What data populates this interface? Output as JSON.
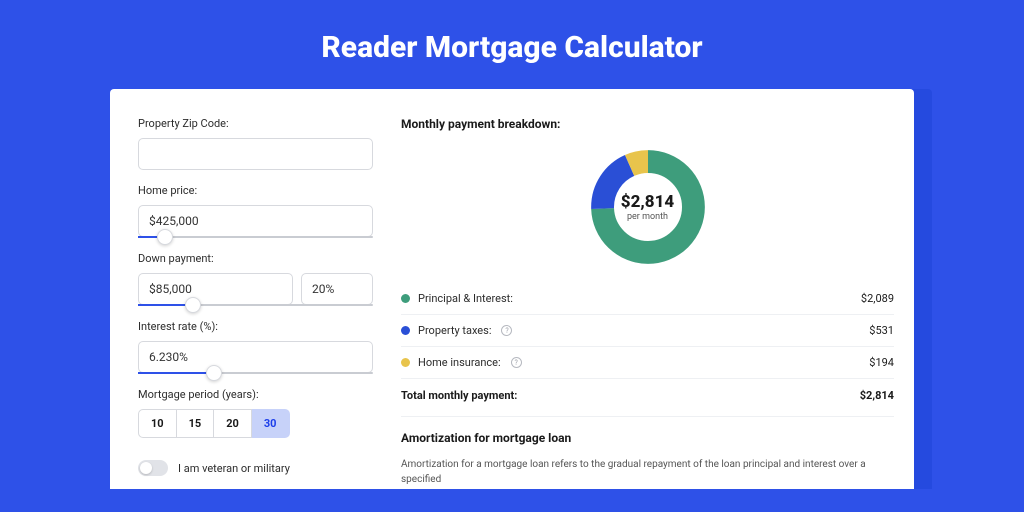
{
  "hero": {
    "title": "Reader Mortgage Calculator"
  },
  "form": {
    "zip": {
      "label": "Property Zip Code:",
      "value": ""
    },
    "home_price": {
      "label": "Home price:",
      "value": "$425,000",
      "slider_pct": 8
    },
    "down": {
      "label": "Down payment:",
      "amount": "$85,000",
      "percent": "20%",
      "slider_pct": 20
    },
    "rate": {
      "label": "Interest rate (%):",
      "value": "6.230%",
      "slider_pct": 29
    },
    "period": {
      "label": "Mortgage period (years):",
      "options": [
        "10",
        "15",
        "20",
        "30"
      ],
      "selected": "30"
    },
    "veteran": {
      "label": "I am veteran or military",
      "checked": false
    }
  },
  "breakdown": {
    "title": "Monthly payment breakdown:",
    "center_amount": "$2,814",
    "center_sub": "per month",
    "items": [
      {
        "label": "Principal & Interest:",
        "value": "$2,089",
        "color": "#3e9d7c",
        "has_info": false
      },
      {
        "label": "Property taxes:",
        "value": "$531",
        "color": "#2a4fd6",
        "has_info": true
      },
      {
        "label": "Home insurance:",
        "value": "$194",
        "color": "#e8c44c",
        "has_info": true
      }
    ],
    "total_label": "Total monthly payment:",
    "total_value": "$2,814"
  },
  "chart_data": {
    "type": "pie",
    "title": "Monthly payment breakdown",
    "series": [
      {
        "name": "Principal & Interest",
        "value": 2089,
        "color": "#3e9d7c"
      },
      {
        "name": "Property taxes",
        "value": 531,
        "color": "#2a4fd6"
      },
      {
        "name": "Home insurance",
        "value": 194,
        "color": "#e8c44c"
      }
    ],
    "total": 2814
  },
  "amortization": {
    "title": "Amortization for mortgage loan",
    "body": "Amortization for a mortgage loan refers to the gradual repayment of the loan principal and interest over a specified"
  }
}
